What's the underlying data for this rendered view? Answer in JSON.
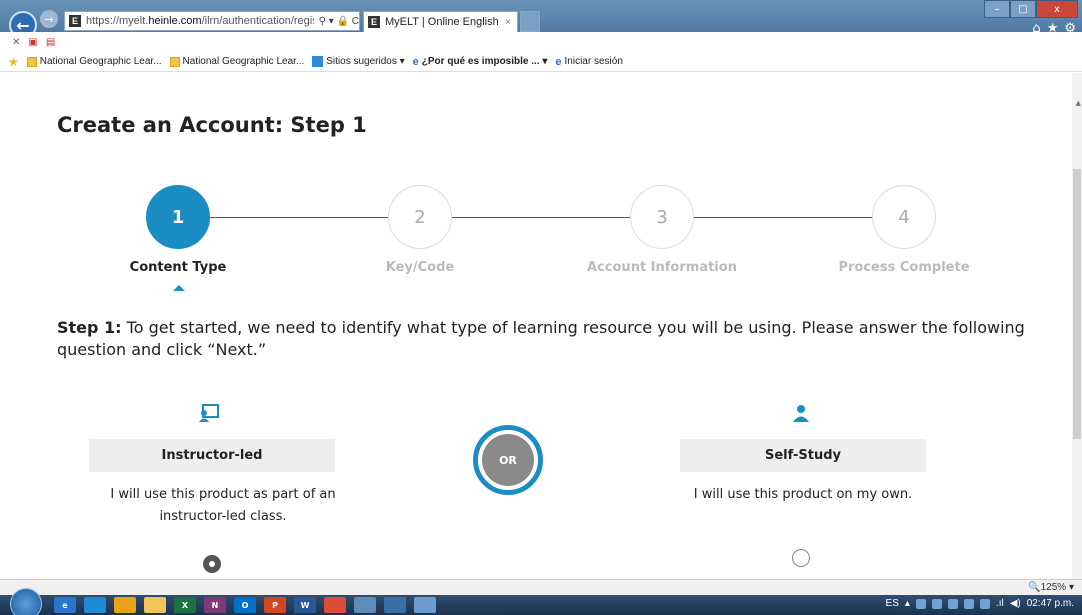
{
  "browser": {
    "url_prefix": "https://myelt.",
    "url_domain": "heinle.com",
    "url_path": "/ilrn/authentication/regist",
    "address_icons": "⚲ ▾ 🔒 C",
    "site_icon_letter": "E",
    "tab_title": "MyELT | Online English Lan...",
    "tab_close": "×",
    "minimize": "–",
    "maximize": "□",
    "close": "x",
    "home_icon": "⌂",
    "star_icon": "★",
    "gear_icon": "⚙"
  },
  "favorites": [
    {
      "label": "National Geographic Lear...",
      "icon": "folder"
    },
    {
      "label": "National Geographic Lear...",
      "icon": "folder"
    },
    {
      "label": "Sitios sugeridos ▾",
      "icon": "sites"
    },
    {
      "label": "¿Por qué es imposible ... ▾",
      "icon": "ie"
    },
    {
      "label": "Iniciar sesión",
      "icon": "ie"
    }
  ],
  "page": {
    "title": "Create an Account: Step 1",
    "steps": [
      {
        "number": "1",
        "label": "Content Type",
        "active": true
      },
      {
        "number": "2",
        "label": "Key/Code",
        "active": false
      },
      {
        "number": "3",
        "label": "Account Information",
        "active": false
      },
      {
        "number": "4",
        "label": "Process Complete",
        "active": false
      }
    ],
    "intro_bold": "Step 1:",
    "intro_text": " To get started, we need to identify what type of learning resource you will be using. Please answer the following question and click “Next.”",
    "option_left": {
      "label": "Instructor-led",
      "description": "I will use this product as part of an instructor-led class.",
      "selected": true
    },
    "or_label": "OR",
    "option_right": {
      "label": "Self-Study",
      "description": "I will use this product on my own.",
      "selected": false
    }
  },
  "status": {
    "zoom": "🔍125%  ▾"
  },
  "taskbar": {
    "lang": "ES",
    "clock": "02:47 p.m.",
    "apps": [
      {
        "name": "ie-taskbar-icon",
        "color": "#2a75c9",
        "glyph": "e"
      },
      {
        "name": "app-taskbar-icon",
        "color": "#1f8bd6",
        "glyph": ""
      },
      {
        "name": "chrome-taskbar-icon",
        "color": "#e8a316",
        "glyph": ""
      },
      {
        "name": "explorer-taskbar-icon",
        "color": "#f2c55c",
        "glyph": ""
      },
      {
        "name": "excel-taskbar-icon",
        "color": "#1e7145",
        "glyph": "X"
      },
      {
        "name": "onenote-taskbar-icon",
        "color": "#80397b",
        "glyph": "N"
      },
      {
        "name": "outlook-taskbar-icon",
        "color": "#0072c6",
        "glyph": "O"
      },
      {
        "name": "powerpoint-taskbar-icon",
        "color": "#d24726",
        "glyph": "P"
      },
      {
        "name": "word-taskbar-icon",
        "color": "#2b579a",
        "glyph": "W"
      },
      {
        "name": "chrome2-taskbar-icon",
        "color": "#dd4b39",
        "glyph": ""
      },
      {
        "name": "window-taskbar-icon",
        "color": "#5f8bb8",
        "glyph": ""
      },
      {
        "name": "media-taskbar-icon",
        "color": "#3a6ea5",
        "glyph": ""
      },
      {
        "name": "screen-taskbar-icon",
        "color": "#6c9cd0",
        "glyph": ""
      }
    ]
  }
}
